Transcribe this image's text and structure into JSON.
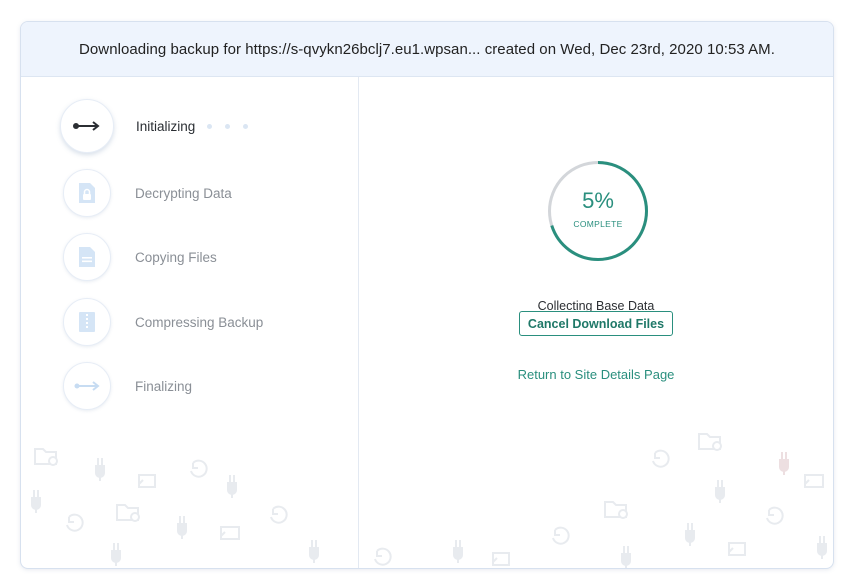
{
  "header": {
    "title": "Downloading backup for https://s-qvykn26bclj7.eu1.wpsan... created on Wed, Dec 23rd, 2020 10:53 AM."
  },
  "steps": [
    {
      "label": "Initializing",
      "icon": "arrow-right-icon",
      "active": true
    },
    {
      "label": "Decrypting Data",
      "icon": "lock-file-icon",
      "active": false
    },
    {
      "label": "Copying Files",
      "icon": "document-icon",
      "active": false
    },
    {
      "label": "Compressing Backup",
      "icon": "zip-file-icon",
      "active": false
    },
    {
      "label": "Finalizing",
      "icon": "double-arrow-icon",
      "active": false
    }
  ],
  "progress": {
    "percent_label": "5%",
    "percent_value": 0.7,
    "complete_label": "COMPLETE"
  },
  "status_text": "Collecting Base Data",
  "actions": {
    "cancel_label": "Cancel Download Files",
    "return_label": "Return to Site Details Page"
  },
  "colors": {
    "accent": "#2a8f7e",
    "header_bg": "#eef4fd",
    "inactive_icon": "#c7dcf2"
  }
}
